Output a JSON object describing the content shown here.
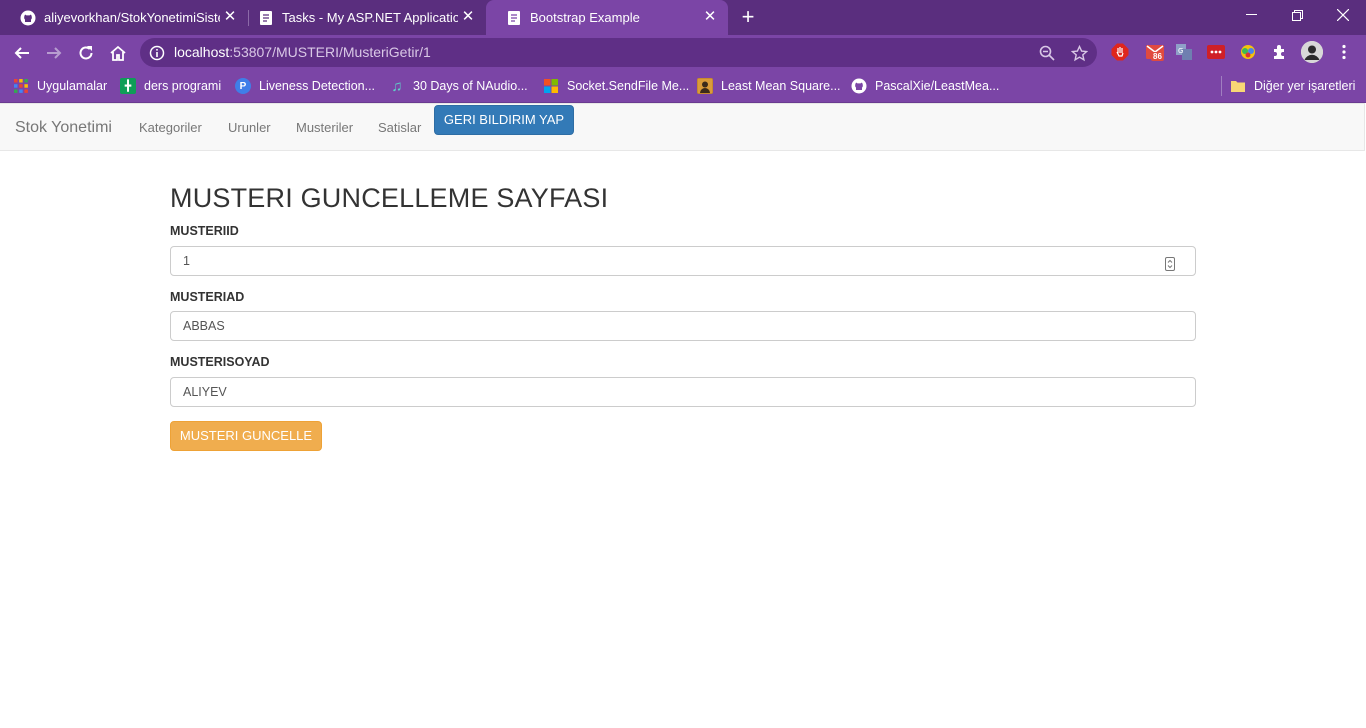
{
  "browser": {
    "tabs": [
      {
        "title": "aliyevorkhan/StokYonetimiSistemi",
        "icon": "github-icon"
      },
      {
        "title": "Tasks - My ASP.NET Application",
        "icon": "page-icon"
      },
      {
        "title": "Bootstrap Example",
        "icon": "page-icon",
        "active": true
      }
    ],
    "url_host": "localhost",
    "url_path": ":53807/MUSTERI/MusteriGetir/1",
    "extension_badge": "86",
    "bookmarks": [
      {
        "label": "Uygulamalar",
        "icon": "apps-grid-icon"
      },
      {
        "label": "ders programi",
        "icon": "sheets-icon"
      },
      {
        "label": "Liveness Detection...",
        "icon": "p-icon"
      },
      {
        "label": "30 Days of NAudio...",
        "icon": "music-note-icon"
      },
      {
        "label": "Socket.SendFile Me...",
        "icon": "microsoft-icon"
      },
      {
        "label": "Least Mean Square...",
        "icon": "avatar-icon"
      },
      {
        "label": "PascalXie/LeastMea...",
        "icon": "github-icon"
      }
    ],
    "other_bookmarks": "Diğer yer işaretleri",
    "colors": {
      "frame": "#5a2e7e",
      "toolbar": "#7b45a6"
    }
  },
  "navbar": {
    "brand": "Stok Yonetimi",
    "links": [
      "Kategoriler",
      "Urunler",
      "Musteriler",
      "Satislar"
    ],
    "feedback_button": "GERI BILDIRIM YAP"
  },
  "form": {
    "title": "MUSTERI GUNCELLEME SAYFASI",
    "fields": [
      {
        "label": "MUSTERIID",
        "value": "1"
      },
      {
        "label": "MUSTERIAD",
        "value": "ABBAS"
      },
      {
        "label": "MUSTERISOYAD",
        "value": "ALIYEV"
      }
    ],
    "submit": "MUSTERI GUNCELLE",
    "colors": {
      "primary": "#337ab7",
      "warning": "#f0ad4e"
    }
  }
}
